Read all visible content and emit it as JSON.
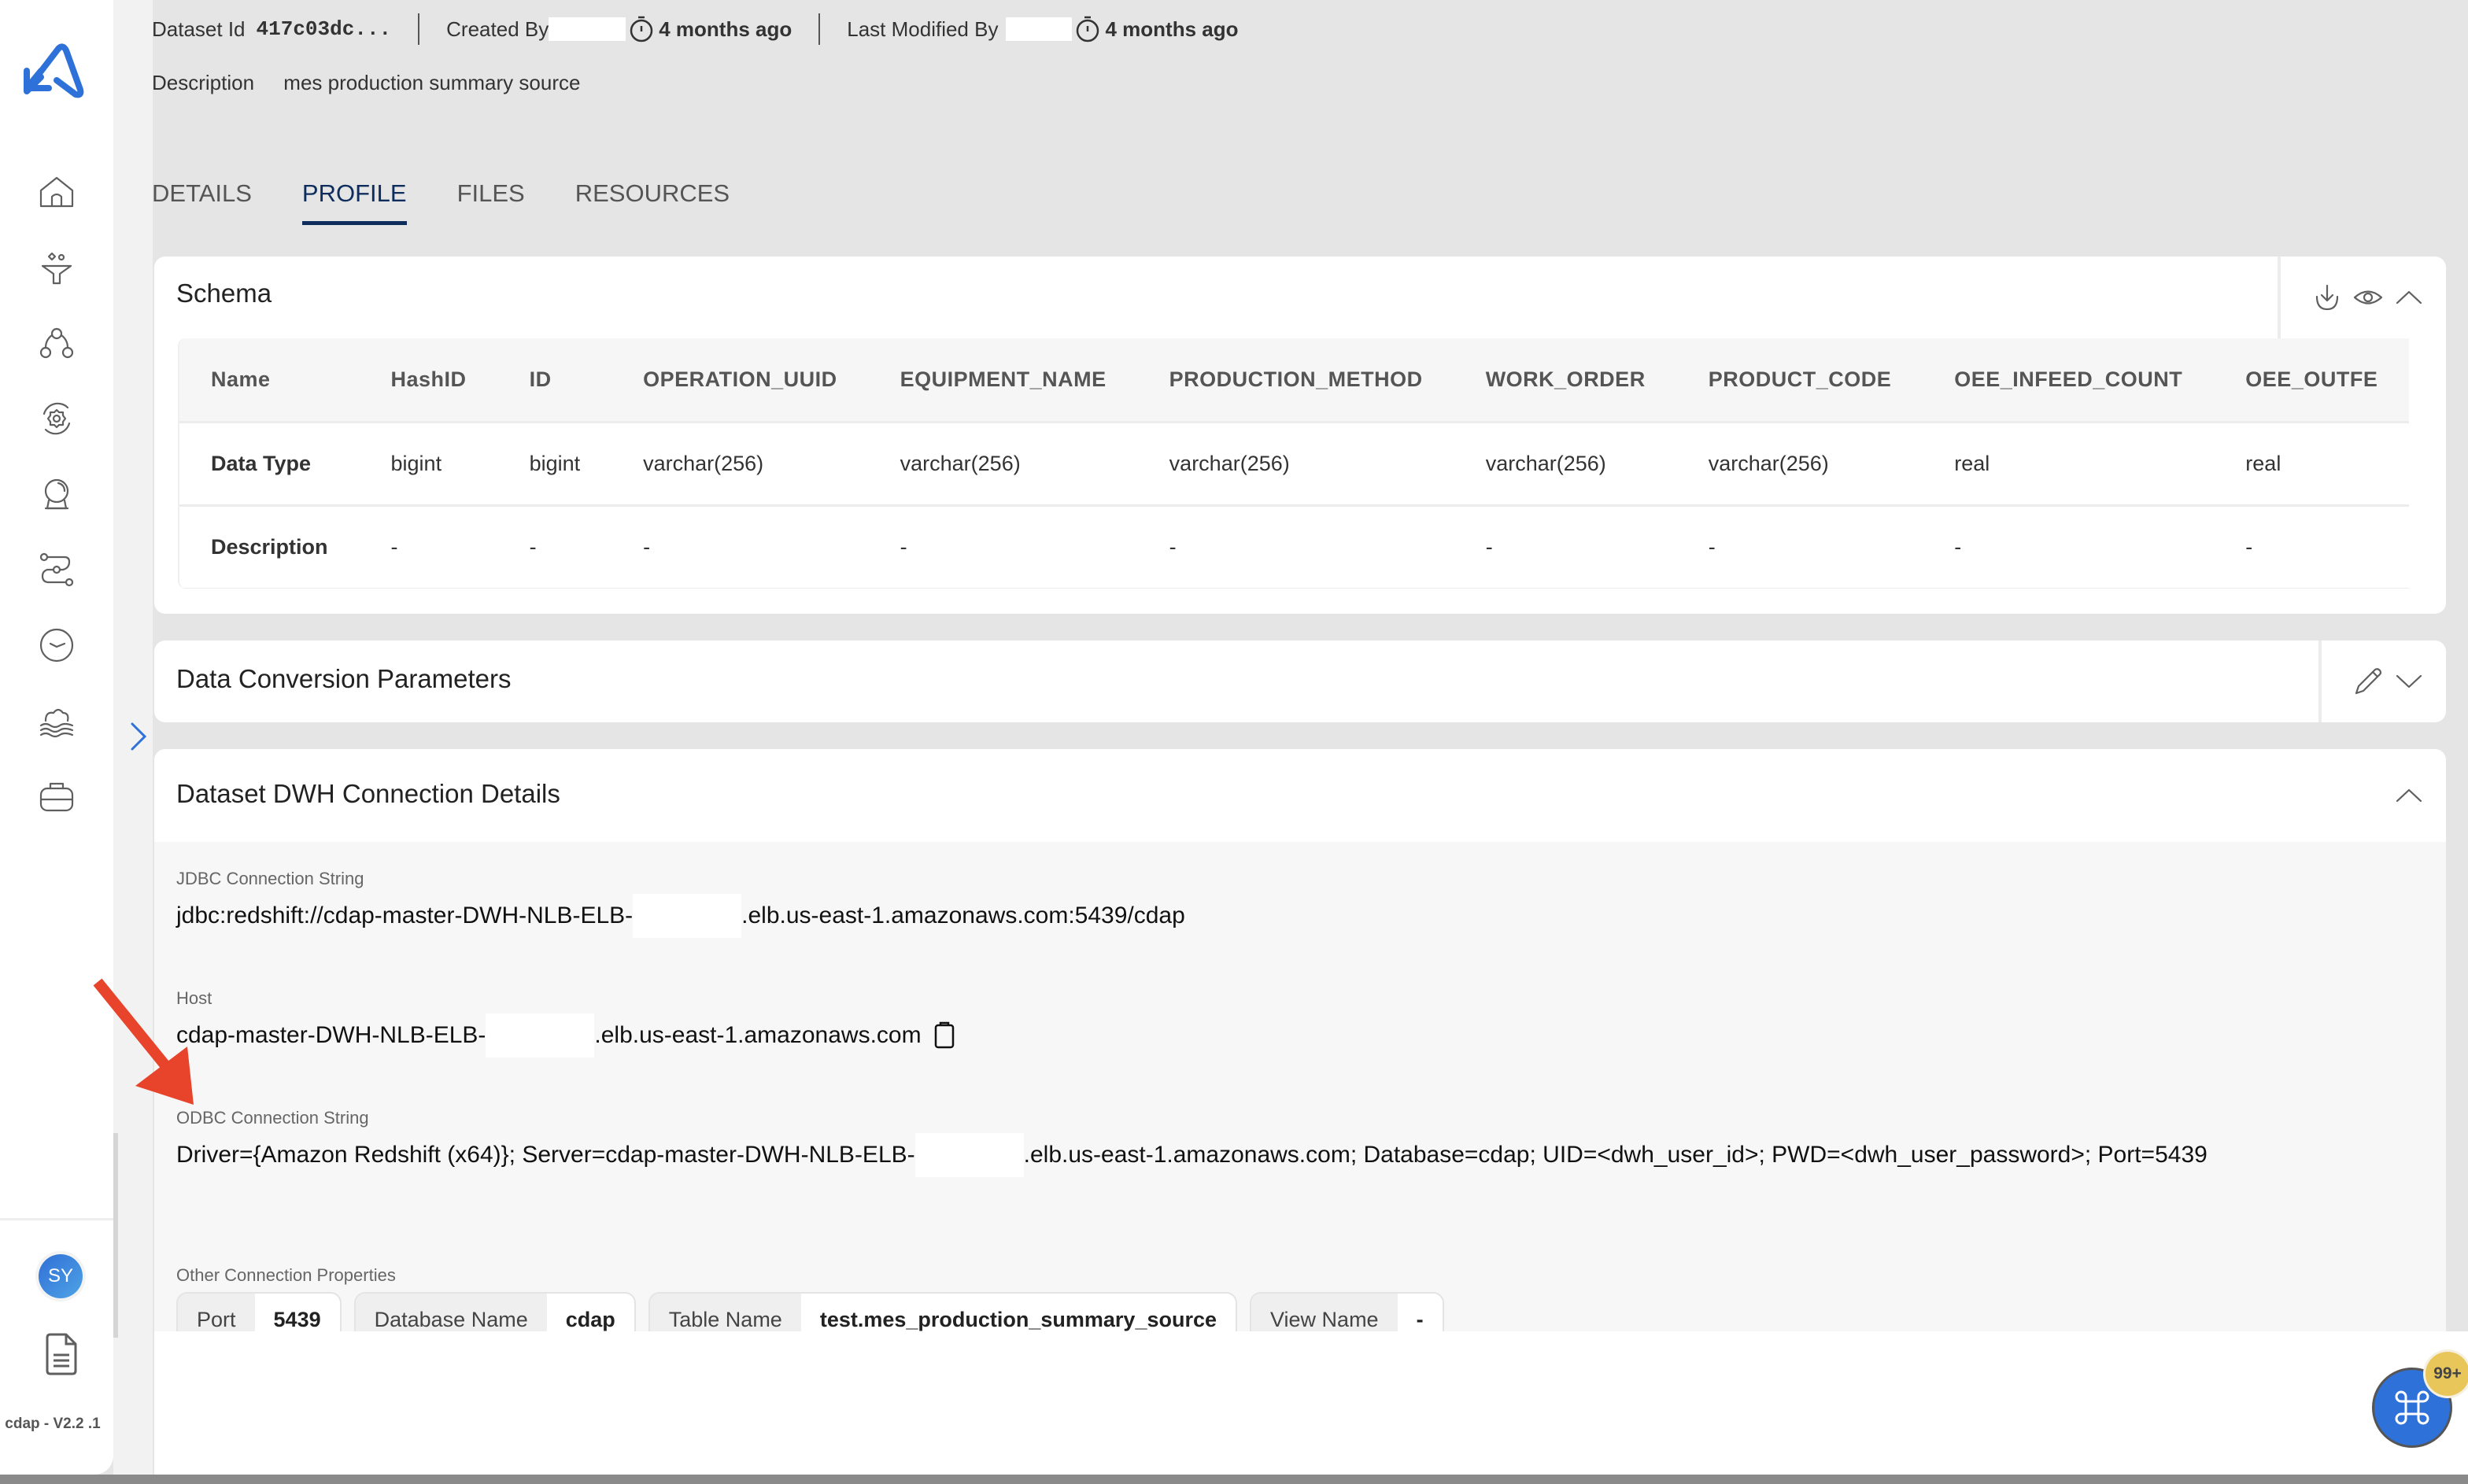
{
  "app": {
    "version_label": "cdap - V2.2 .1",
    "user_initials": "SY"
  },
  "sidebar": {
    "items": [
      {
        "name": "home",
        "icon": "home-icon"
      },
      {
        "name": "data-ingestion",
        "icon": "funnel-icon"
      },
      {
        "name": "data-model",
        "icon": "hierarchy-icon"
      },
      {
        "name": "processing",
        "icon": "gear-cycle-icon"
      },
      {
        "name": "insights",
        "icon": "crystal-ball-icon"
      },
      {
        "name": "pipelines",
        "icon": "route-icon"
      },
      {
        "name": "schedules",
        "icon": "clock-icon"
      },
      {
        "name": "data-lake",
        "icon": "lake-icon"
      },
      {
        "name": "resources",
        "icon": "briefcase-icon"
      }
    ]
  },
  "header": {
    "dataset_id_label": "Dataset Id",
    "dataset_id_value": "417c03dc...",
    "created_by_label": "Created By",
    "created_time": "4 months ago",
    "last_modified_by_label": "Last Modified By",
    "last_modified_time": "4 months ago",
    "description_label": "Description",
    "description_value": "mes production summary source"
  },
  "tabs": [
    {
      "label": "DETAILS",
      "active": false
    },
    {
      "label": "PROFILE",
      "active": true
    },
    {
      "label": "FILES",
      "active": false
    },
    {
      "label": "RESOURCES",
      "active": false
    }
  ],
  "schema": {
    "title": "Schema",
    "row_labels": [
      "Name",
      "Data Type",
      "Description"
    ],
    "columns": [
      {
        "name": "HashID",
        "type": "bigint",
        "description": "-"
      },
      {
        "name": "ID",
        "type": "bigint",
        "description": "-"
      },
      {
        "name": "OPERATION_UUID",
        "type": "varchar(256)",
        "description": "-"
      },
      {
        "name": "EQUIPMENT_NAME",
        "type": "varchar(256)",
        "description": "-"
      },
      {
        "name": "PRODUCTION_METHOD",
        "type": "varchar(256)",
        "description": "-"
      },
      {
        "name": "WORK_ORDER",
        "type": "varchar(256)",
        "description": "-"
      },
      {
        "name": "PRODUCT_CODE",
        "type": "varchar(256)",
        "description": "-"
      },
      {
        "name": "OEE_INFEED_COUNT",
        "type": "real",
        "description": "-"
      },
      {
        "name": "OEE_OUTFE",
        "type": "real",
        "description": "-"
      }
    ]
  },
  "data_conversion": {
    "title": "Data Conversion Parameters"
  },
  "dwh": {
    "title": "Dataset DWH Connection Details",
    "jdbc_label": "JDBC Connection String",
    "jdbc_prefix": "jdbc:redshift://cdap-master-DWH-NLB-ELB-",
    "jdbc_suffix": ".elb.us-east-1.amazonaws.com:5439/cdap",
    "host_label": "Host",
    "host_prefix": "cdap-master-DWH-NLB-ELB-",
    "host_suffix": ".elb.us-east-1.amazonaws.com",
    "odbc_label": "ODBC Connection String",
    "odbc_prefix": "Driver={Amazon Redshift (x64)}; Server=cdap-master-DWH-NLB-ELB-",
    "odbc_suffix": ".elb.us-east-1.amazonaws.com; Database=cdap; UID=<dwh_user_id>; PWD=<dwh_user_password>; Port=5439",
    "other_label": "Other Connection Properties",
    "properties": [
      {
        "key": "Port",
        "value": "5439"
      },
      {
        "key": "Database Name",
        "value": "cdap"
      },
      {
        "key": "Table Name",
        "value": "test.mes_production_summary_source"
      },
      {
        "key": "View Name",
        "value": "-"
      }
    ]
  },
  "fab": {
    "badge": "99+"
  },
  "colors": {
    "accent": "#2e72d9",
    "active_tab": "#0f2d5c",
    "badge": "#e8c65a",
    "annotation_arrow": "#e8432b"
  }
}
